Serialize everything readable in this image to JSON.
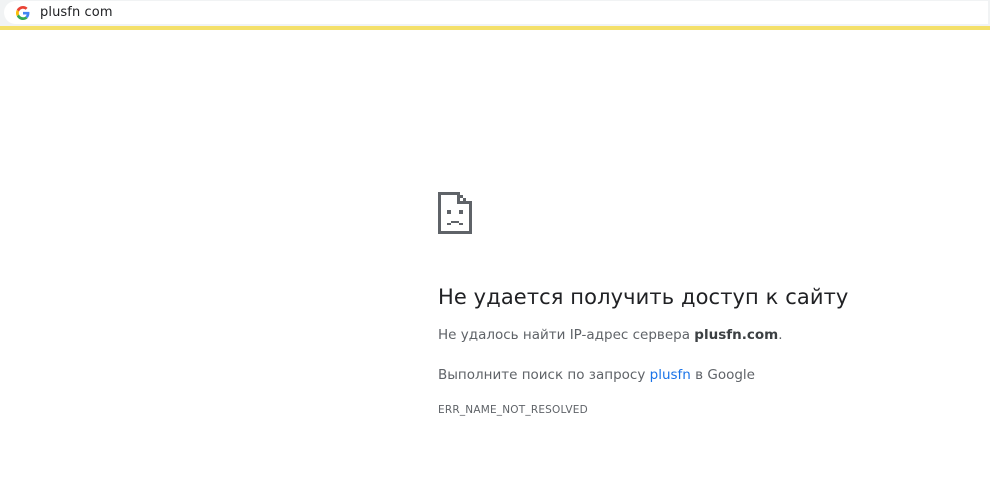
{
  "omnibox": {
    "icon": "google-g-icon",
    "url": "plusfn com"
  },
  "error": {
    "icon": "sad-document-icon",
    "title": "Не удается получить доступ к сайту",
    "desc_prefix": "Не удалось найти IP-адрес сервера ",
    "desc_host": "plusfn.com",
    "desc_suffix": ".",
    "suggest_prefix": "Выполните поиск по запросу ",
    "suggest_link": "plusfn",
    "suggest_suffix": " в Google",
    "code": "ERR_NAME_NOT_RESOLVED"
  },
  "colors": {
    "accent_strip": "#f4e06a",
    "link": "#1a73e8",
    "text_dark": "#202124",
    "text_muted": "#5f6368"
  }
}
